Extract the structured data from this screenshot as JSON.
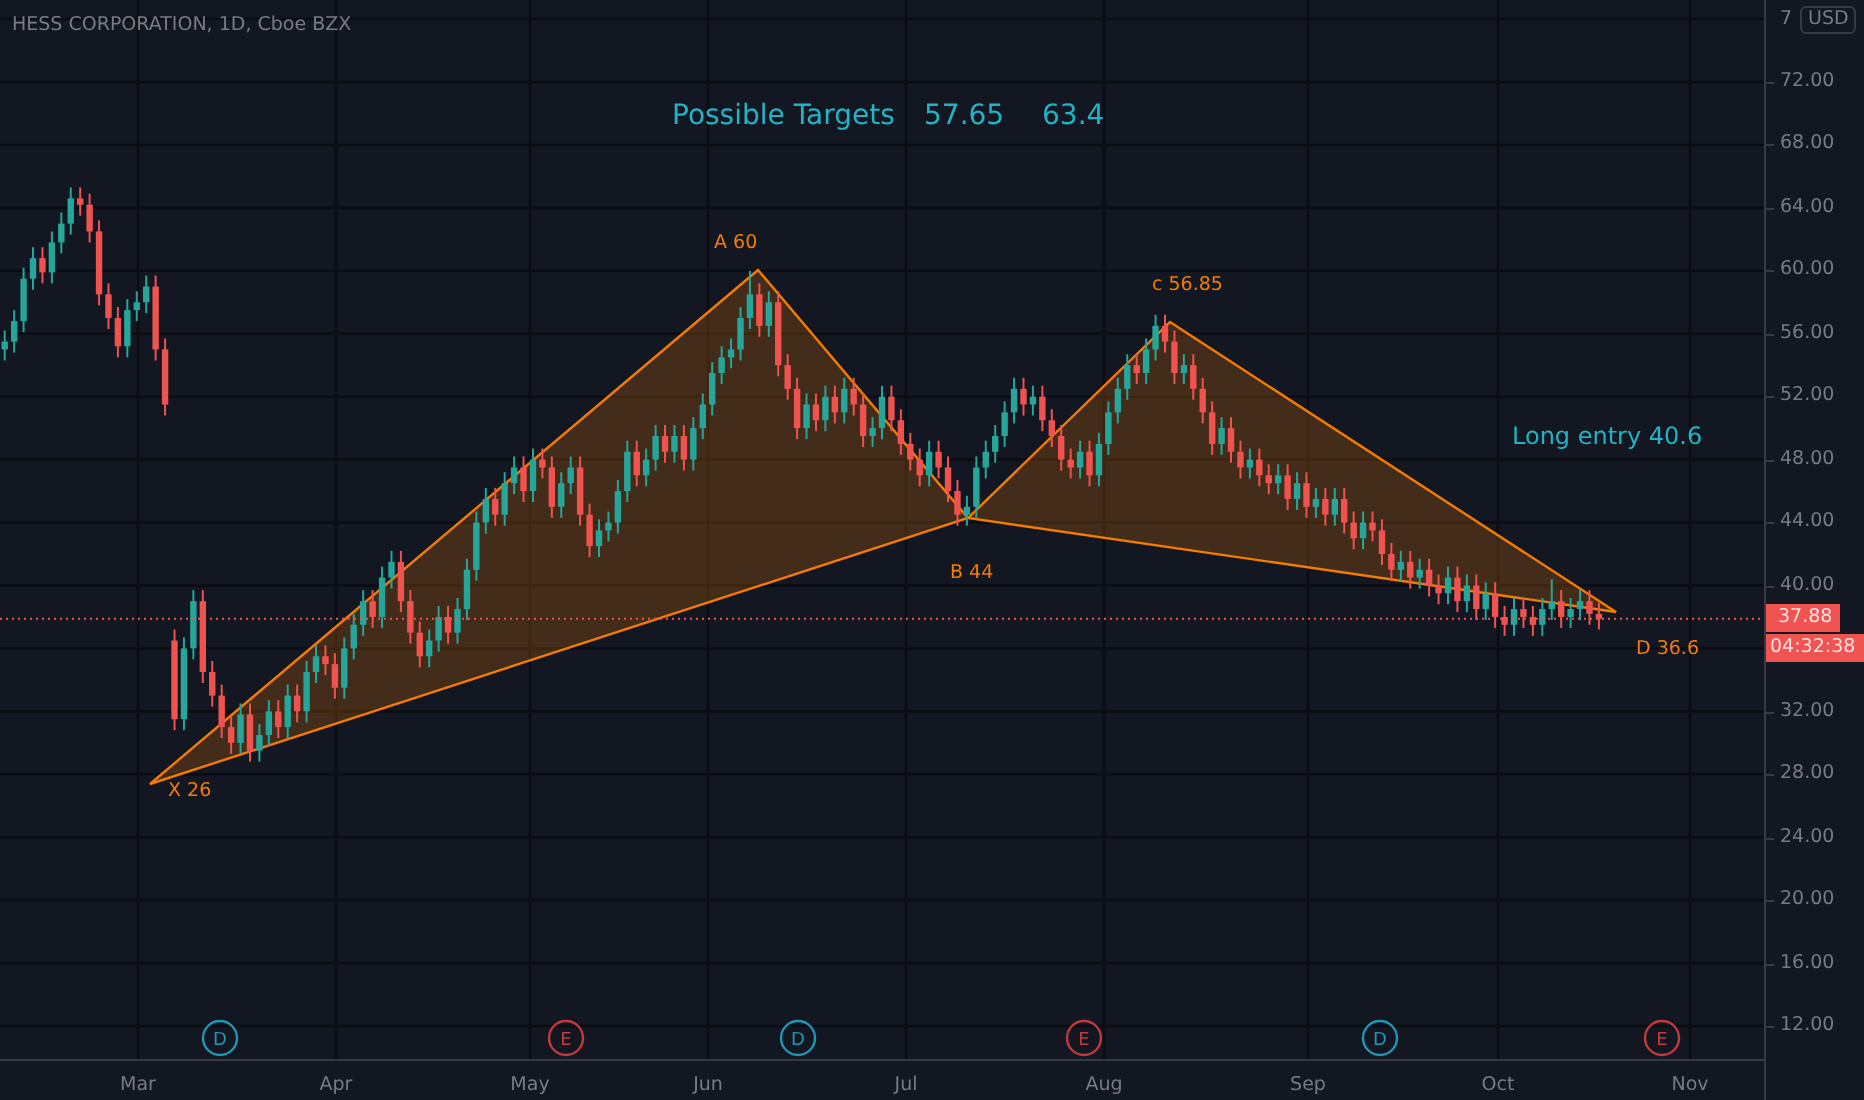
{
  "header": {
    "title": "HESS CORPORATION, 1D, Cboe BZX"
  },
  "targets_note": {
    "label": "Possible Targets",
    "values": [
      "57.65",
      "63.4"
    ]
  },
  "entry_note": "Long entry 40.6",
  "pattern": {
    "points": [
      {
        "label": "X 26"
      },
      {
        "label": "A 60"
      },
      {
        "label": "B 44"
      },
      {
        "label": "c 56.85"
      },
      {
        "label": "D 36.6"
      }
    ]
  },
  "price_chart": {
    "chart_data": {
      "type": "candlestick",
      "grid": true,
      "ylim": [
        9.84,
        77.21
      ],
      "ref_lines": [
        {
          "axis": "y",
          "value": 37.88
        }
      ],
      "yticks": [
        {
          "value": 72,
          "label": "72.00"
        },
        {
          "value": 68,
          "label": "68.00"
        },
        {
          "value": 64,
          "label": "64.00"
        },
        {
          "value": 60,
          "label": "60.00"
        },
        {
          "value": 56,
          "label": "56.00"
        },
        {
          "value": 52,
          "label": "52.00"
        },
        {
          "value": 48,
          "label": "48.00"
        },
        {
          "value": 44,
          "label": "44.00"
        },
        {
          "value": 40,
          "label": "40.00"
        },
        {
          "value": 32,
          "label": "32.00"
        },
        {
          "value": 28,
          "label": "28.00"
        },
        {
          "value": 24,
          "label": "24.00"
        },
        {
          "value": 20,
          "label": "20.00"
        },
        {
          "value": 16,
          "label": "16.00"
        },
        {
          "value": 12,
          "label": "12.00"
        }
      ],
      "categories": [
        null,
        null,
        null,
        null,
        null,
        null,
        null,
        null,
        null,
        null,
        null,
        null,
        null,
        null,
        null,
        null,
        null,
        null,
        null,
        null,
        null,
        null,
        null,
        null,
        null,
        null,
        null,
        null,
        null,
        null,
        null,
        null,
        null,
        null,
        null,
        null,
        null,
        null,
        null,
        null,
        null,
        null,
        null,
        null,
        null,
        null,
        null,
        null,
        null,
        null,
        null,
        null,
        null,
        null,
        null,
        null,
        null,
        null,
        null,
        null,
        null,
        null,
        null,
        null,
        null,
        null,
        null,
        null,
        null,
        null,
        null,
        null,
        null,
        null,
        null,
        null,
        null,
        null,
        null,
        null,
        null,
        null,
        null,
        null,
        null,
        null,
        null,
        null,
        null,
        null,
        null,
        null,
        null,
        null,
        null,
        null,
        null,
        null,
        null,
        null,
        null,
        null,
        null,
        null,
        null,
        null,
        null,
        null,
        null,
        null,
        null,
        null,
        null,
        null,
        null,
        null,
        null,
        null,
        null,
        null,
        null,
        null,
        null,
        null,
        null,
        null,
        null,
        null,
        null,
        null,
        null,
        null,
        null,
        null,
        null,
        null,
        null,
        null,
        null,
        null,
        null,
        null,
        null,
        null,
        null,
        null,
        null,
        null,
        null,
        null,
        null,
        null,
        null,
        null,
        null,
        null,
        null,
        null,
        null,
        null,
        null,
        null,
        null,
        null,
        null,
        null,
        null,
        null,
        null,
        null,
        null,
        null,
        null,
        null,
        null,
        null,
        null,
        null,
        null,
        null,
        null,
        null,
        null,
        null,
        null,
        null,
        null
      ],
      "ohlc": [
        [
          55.0,
          56.2,
          54.3,
          55.5
        ],
        [
          55.5,
          57.5,
          54.8,
          56.8
        ],
        [
          56.8,
          60.2,
          56.1,
          59.5
        ],
        [
          59.5,
          61.5,
          58.8,
          60.8
        ],
        [
          60.8,
          61.5,
          59.2,
          59.9
        ],
        [
          59.9,
          62.5,
          59.2,
          61.8
        ],
        [
          61.8,
          63.7,
          61.1,
          63.0
        ],
        [
          63.0,
          65.3,
          62.3,
          64.6
        ],
        [
          64.6,
          65.3,
          63.5,
          64.2
        ],
        [
          64.2,
          64.9,
          61.8,
          62.5
        ],
        [
          62.5,
          63.2,
          57.8,
          58.5
        ],
        [
          58.5,
          59.2,
          56.3,
          57.0
        ],
        [
          57.0,
          57.7,
          54.5,
          55.2
        ],
        [
          55.2,
          58.2,
          54.5,
          57.5
        ],
        [
          57.5,
          58.7,
          56.8,
          58.0
        ],
        [
          58.0,
          59.7,
          57.3,
          59.0
        ],
        [
          59.0,
          59.7,
          54.3,
          55.0
        ],
        [
          55.0,
          55.7,
          50.8,
          51.5
        ],
        [
          36.5,
          37.2,
          30.8,
          31.5
        ],
        [
          31.5,
          36.7,
          30.8,
          36.0
        ],
        [
          36.0,
          39.7,
          35.3,
          39.0
        ],
        [
          39.0,
          39.7,
          33.8,
          34.5
        ],
        [
          34.5,
          35.2,
          32.3,
          33.0
        ],
        [
          33.0,
          33.7,
          30.3,
          31.0
        ],
        [
          31.0,
          31.7,
          29.3,
          30.0
        ],
        [
          30.0,
          32.5,
          29.3,
          31.8
        ],
        [
          31.8,
          32.5,
          28.8,
          29.5
        ],
        [
          29.5,
          31.2,
          28.8,
          30.5
        ],
        [
          30.5,
          32.7,
          29.8,
          32.0
        ],
        [
          32.0,
          32.7,
          30.3,
          31.0
        ],
        [
          31.0,
          33.7,
          30.3,
          33.0
        ],
        [
          33.0,
          33.7,
          31.3,
          32.0
        ],
        [
          32.0,
          35.2,
          31.3,
          34.5
        ],
        [
          34.5,
          36.2,
          33.8,
          35.5
        ],
        [
          35.5,
          36.2,
          34.3,
          35.0
        ],
        [
          35.0,
          35.7,
          32.8,
          33.5
        ],
        [
          33.5,
          36.7,
          32.8,
          36.0
        ],
        [
          36.0,
          38.2,
          35.3,
          37.5
        ],
        [
          37.5,
          39.7,
          36.8,
          39.0
        ],
        [
          39.0,
          39.7,
          37.3,
          38.0
        ],
        [
          38.0,
          41.2,
          37.3,
          40.5
        ],
        [
          40.5,
          42.2,
          39.8,
          41.5
        ],
        [
          41.5,
          42.2,
          38.3,
          39.0
        ],
        [
          39.0,
          39.7,
          36.3,
          37.0
        ],
        [
          37.0,
          37.7,
          34.8,
          35.5
        ],
        [
          35.5,
          37.2,
          34.8,
          36.5
        ],
        [
          36.5,
          38.7,
          35.8,
          38.0
        ],
        [
          38.0,
          38.7,
          36.3,
          37.0
        ],
        [
          37.0,
          39.2,
          36.3,
          38.5
        ],
        [
          38.5,
          41.7,
          37.8,
          41.0
        ],
        [
          41.0,
          44.7,
          40.3,
          44.0
        ],
        [
          44.0,
          46.2,
          43.3,
          45.5
        ],
        [
          45.5,
          46.2,
          43.8,
          44.5
        ],
        [
          44.5,
          47.2,
          43.8,
          46.5
        ],
        [
          46.5,
          48.2,
          45.8,
          47.5
        ],
        [
          47.5,
          48.2,
          45.3,
          46.0
        ],
        [
          46.0,
          48.7,
          45.3,
          48.0
        ],
        [
          48.0,
          48.7,
          46.8,
          47.5
        ],
        [
          47.5,
          48.2,
          44.3,
          45.0
        ],
        [
          45.0,
          47.2,
          44.3,
          46.5
        ],
        [
          46.5,
          48.2,
          45.8,
          47.5
        ],
        [
          47.5,
          48.2,
          43.8,
          44.5
        ],
        [
          44.5,
          45.2,
          41.8,
          42.5
        ],
        [
          42.5,
          44.2,
          41.8,
          43.5
        ],
        [
          43.5,
          44.7,
          42.8,
          44.0
        ],
        [
          44.0,
          46.7,
          43.3,
          46.0
        ],
        [
          46.0,
          49.2,
          45.3,
          48.5
        ],
        [
          48.5,
          49.2,
          46.3,
          47.0
        ],
        [
          47.0,
          48.7,
          46.3,
          48.0
        ],
        [
          48.0,
          50.2,
          47.3,
          49.5
        ],
        [
          49.5,
          50.2,
          47.8,
          48.5
        ],
        [
          48.5,
          50.2,
          47.8,
          49.5
        ],
        [
          49.5,
          50.2,
          47.3,
          48.0
        ],
        [
          48.0,
          50.7,
          47.3,
          50.0
        ],
        [
          50.0,
          52.2,
          49.3,
          51.5
        ],
        [
          51.5,
          54.2,
          50.8,
          53.5
        ],
        [
          53.5,
          55.2,
          52.8,
          54.5
        ],
        [
          54.5,
          55.7,
          53.8,
          55.0
        ],
        [
          55.0,
          57.7,
          54.3,
          57.0
        ],
        [
          57.0,
          60.0,
          56.3,
          58.5
        ],
        [
          58.5,
          59.2,
          55.8,
          56.5
        ],
        [
          56.5,
          58.7,
          55.8,
          58.0
        ],
        [
          58.0,
          58.7,
          53.3,
          54.0
        ],
        [
          54.0,
          54.7,
          51.8,
          52.5
        ],
        [
          52.5,
          53.2,
          49.3,
          50.0
        ],
        [
          50.0,
          52.2,
          49.3,
          51.5
        ],
        [
          51.5,
          52.2,
          49.8,
          50.5
        ],
        [
          50.5,
          52.7,
          49.8,
          52.0
        ],
        [
          52.0,
          52.7,
          50.3,
          51.0
        ],
        [
          51.0,
          53.2,
          50.3,
          52.5
        ],
        [
          52.5,
          53.2,
          50.8,
          51.5
        ],
        [
          51.5,
          52.2,
          48.8,
          49.5
        ],
        [
          49.5,
          50.7,
          48.8,
          50.0
        ],
        [
          50.0,
          52.7,
          49.3,
          52.0
        ],
        [
          52.0,
          52.7,
          49.8,
          50.5
        ],
        [
          50.5,
          51.2,
          48.3,
          49.0
        ],
        [
          49.0,
          49.7,
          47.3,
          48.0
        ],
        [
          48.0,
          48.7,
          46.3,
          47.0
        ],
        [
          47.0,
          49.2,
          46.3,
          48.5
        ],
        [
          48.5,
          49.2,
          46.8,
          47.5
        ],
        [
          47.5,
          48.2,
          45.3,
          46.0
        ],
        [
          46.0,
          46.7,
          43.8,
          44.5
        ],
        [
          44.5,
          45.7,
          43.8,
          45.0
        ],
        [
          45.0,
          48.2,
          44.3,
          47.5
        ],
        [
          47.5,
          49.2,
          46.8,
          48.5
        ],
        [
          48.5,
          50.2,
          47.8,
          49.5
        ],
        [
          49.5,
          51.7,
          48.8,
          51.0
        ],
        [
          51.0,
          53.2,
          50.3,
          52.5
        ],
        [
          52.5,
          53.2,
          50.8,
          51.5
        ],
        [
          51.5,
          52.7,
          50.8,
          52.0
        ],
        [
          52.0,
          52.7,
          49.8,
          50.5
        ],
        [
          50.5,
          51.2,
          48.8,
          49.5
        ],
        [
          49.5,
          50.2,
          47.3,
          48.0
        ],
        [
          48.0,
          48.7,
          46.8,
          47.5
        ],
        [
          47.5,
          49.2,
          46.8,
          48.5
        ],
        [
          48.5,
          49.2,
          46.3,
          47.0
        ],
        [
          47.0,
          49.7,
          46.3,
          49.0
        ],
        [
          49.0,
          51.7,
          48.3,
          51.0
        ],
        [
          51.0,
          53.2,
          50.3,
          52.5
        ],
        [
          52.5,
          54.7,
          51.8,
          54.0
        ],
        [
          54.0,
          54.7,
          52.8,
          53.5
        ],
        [
          53.5,
          55.7,
          52.8,
          55.0
        ],
        [
          55.0,
          57.2,
          54.3,
          56.5
        ],
        [
          56.5,
          57.2,
          54.8,
          55.5
        ],
        [
          55.5,
          56.2,
          52.8,
          53.5
        ],
        [
          53.5,
          54.7,
          52.8,
          54.0
        ],
        [
          54.0,
          54.7,
          51.8,
          52.5
        ],
        [
          52.5,
          53.2,
          50.3,
          51.0
        ],
        [
          51.0,
          51.7,
          48.3,
          49.0
        ],
        [
          49.0,
          50.7,
          48.3,
          50.0
        ],
        [
          50.0,
          50.7,
          47.8,
          48.5
        ],
        [
          48.5,
          49.2,
          46.8,
          47.5
        ],
        [
          47.5,
          48.7,
          46.8,
          48.0
        ],
        [
          48.0,
          48.7,
          46.3,
          47.0
        ],
        [
          47.0,
          47.7,
          45.8,
          46.5
        ],
        [
          46.5,
          47.7,
          45.8,
          47.0
        ],
        [
          47.0,
          47.7,
          44.8,
          45.5
        ],
        [
          45.5,
          47.2,
          44.8,
          46.5
        ],
        [
          46.5,
          47.2,
          44.3,
          45.0
        ],
        [
          45.0,
          46.2,
          44.3,
          45.5
        ],
        [
          45.5,
          46.2,
          43.8,
          44.5
        ],
        [
          44.5,
          46.2,
          43.8,
          45.5
        ],
        [
          45.5,
          46.2,
          43.3,
          44.0
        ],
        [
          44.0,
          44.7,
          42.3,
          43.0
        ],
        [
          43.0,
          44.7,
          42.3,
          44.0
        ],
        [
          44.0,
          44.7,
          42.8,
          43.5
        ],
        [
          43.5,
          44.2,
          41.3,
          42.0
        ],
        [
          42.0,
          42.7,
          40.3,
          41.0
        ],
        [
          41.0,
          42.2,
          40.3,
          41.5
        ],
        [
          41.5,
          42.2,
          39.8,
          40.5
        ],
        [
          40.5,
          41.7,
          39.8,
          41.0
        ],
        [
          41.0,
          41.7,
          39.3,
          40.0
        ],
        [
          40.0,
          40.7,
          38.8,
          39.5
        ],
        [
          39.5,
          41.2,
          38.8,
          40.5
        ],
        [
          40.5,
          41.2,
          38.3,
          39.0
        ],
        [
          39.0,
          40.7,
          38.3,
          40.0
        ],
        [
          40.0,
          40.7,
          37.8,
          38.5
        ],
        [
          38.5,
          40.2,
          37.8,
          39.5
        ],
        [
          39.5,
          40.2,
          37.3,
          38.0
        ],
        [
          38.0,
          38.7,
          36.8,
          37.5
        ],
        [
          37.5,
          39.2,
          36.8,
          38.5
        ],
        [
          38.5,
          39.2,
          37.3,
          38.0
        ],
        [
          38.0,
          38.7,
          36.8,
          37.5
        ],
        [
          37.5,
          39.2,
          36.8,
          38.5
        ],
        [
          38.5,
          40.4,
          37.8,
          39.0
        ],
        [
          39.0,
          39.7,
          37.3,
          38.0
        ],
        [
          38.0,
          39.2,
          37.3,
          38.5
        ],
        [
          38.5,
          39.7,
          37.8,
          39.0
        ],
        [
          39.0,
          39.7,
          37.5,
          38.2
        ],
        [
          38.2,
          38.9,
          37.2,
          37.88
        ],
        null,
        null,
        null,
        null,
        null,
        null,
        null,
        null,
        null,
        null,
        null,
        null,
        null,
        null,
        null,
        null,
        null
      ]
    }
  },
  "price_axis": {
    "top_tick_fragment": "7",
    "currency": "USD",
    "last_price": "37.88",
    "countdown": "04:32:38"
  },
  "time_axis": {
    "ticks": [
      "Mar",
      "Apr",
      "May",
      "Jun",
      "Jul",
      "Aug",
      "Sep",
      "Oct",
      "Nov"
    ]
  },
  "events": [
    {
      "letter": "D",
      "kind": "dividend"
    },
    {
      "letter": "E",
      "kind": "earnings"
    },
    {
      "letter": "D",
      "kind": "dividend"
    },
    {
      "letter": "E",
      "kind": "earnings"
    },
    {
      "letter": "D",
      "kind": "dividend"
    },
    {
      "letter": "E",
      "kind": "earnings"
    }
  ]
}
